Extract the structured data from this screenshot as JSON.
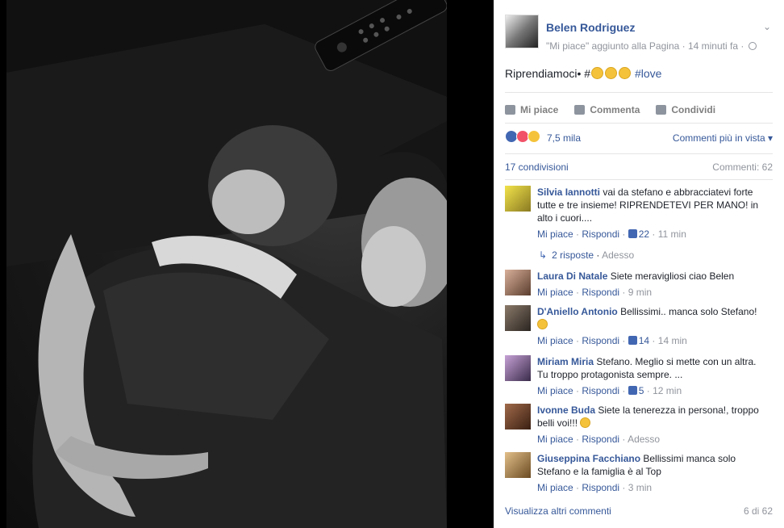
{
  "post": {
    "page_name": "Belen Rodriguez",
    "meta": "\"Mi piace\" aggiunto alla Pagina · 14 minuti fa ·",
    "text_before": "Riprendiamoci• #",
    "hashtag": "#love",
    "actions": [
      "Mi piace",
      "Commenta",
      "Condividi"
    ],
    "reaction_count": "7,5 mila",
    "sort_label": "Commenti più in vista ▾",
    "shares": "17 condivisioni",
    "comment_count": "Commenti: 62"
  },
  "comments": [
    {
      "name": "Silvia Iannotti",
      "text_lines": [
        "vai da stefano e abbracciatevi forte",
        "tutte e tre insieme! RIPRENDETEVI PER MANO! in",
        "alto i cuori...."
      ],
      "like": "Mi piace",
      "reply": "Rispondi",
      "likes": "22",
      "time": "11 min"
    },
    {
      "name": "Laura Di Natale",
      "text_lines": [
        "Siete meravigliosi ciao Belen"
      ],
      "like": "Mi piace",
      "reply": "Rispondi",
      "time": "9 min"
    },
    {
      "name": "D'Aniello Antonio",
      "text_lines": [
        "Bellissimi.. manca solo Stefano!"
      ],
      "like": "Mi piace",
      "reply": "Rispondi",
      "likes": "14",
      "time": "14 min"
    },
    {
      "name": "Miriam Miria",
      "text_lines": [
        "Stefano. Meglio si mette con un altra.",
        "Tu troppo protagonista sempre. ..."
      ],
      "like": "Mi piace",
      "reply": "Rispondi",
      "likes": "5",
      "time": "12 min"
    },
    {
      "name": "Ivonne Buda",
      "text_lines": [
        "Siete la tenerezza in persona!, troppo",
        "belli voi!!!"
      ],
      "like": "Mi piace",
      "reply": "Rispondi",
      "time": "Adesso"
    },
    {
      "name": "Giuseppina Facchiano",
      "text_lines": [
        "Bellissimi manca solo",
        "Stefano e la famiglia è al Top"
      ],
      "like": "Mi piace",
      "reply": "Rispondi",
      "time": "3 min"
    }
  ],
  "replies": {
    "label": "2 risposte",
    "time": "Adesso"
  },
  "footer": {
    "more": "Visualizza altri commenti",
    "pages": "6 di 62"
  },
  "colors": {
    "link": "#365899",
    "meta": "#90949c",
    "like_blue": "#4267b2"
  }
}
